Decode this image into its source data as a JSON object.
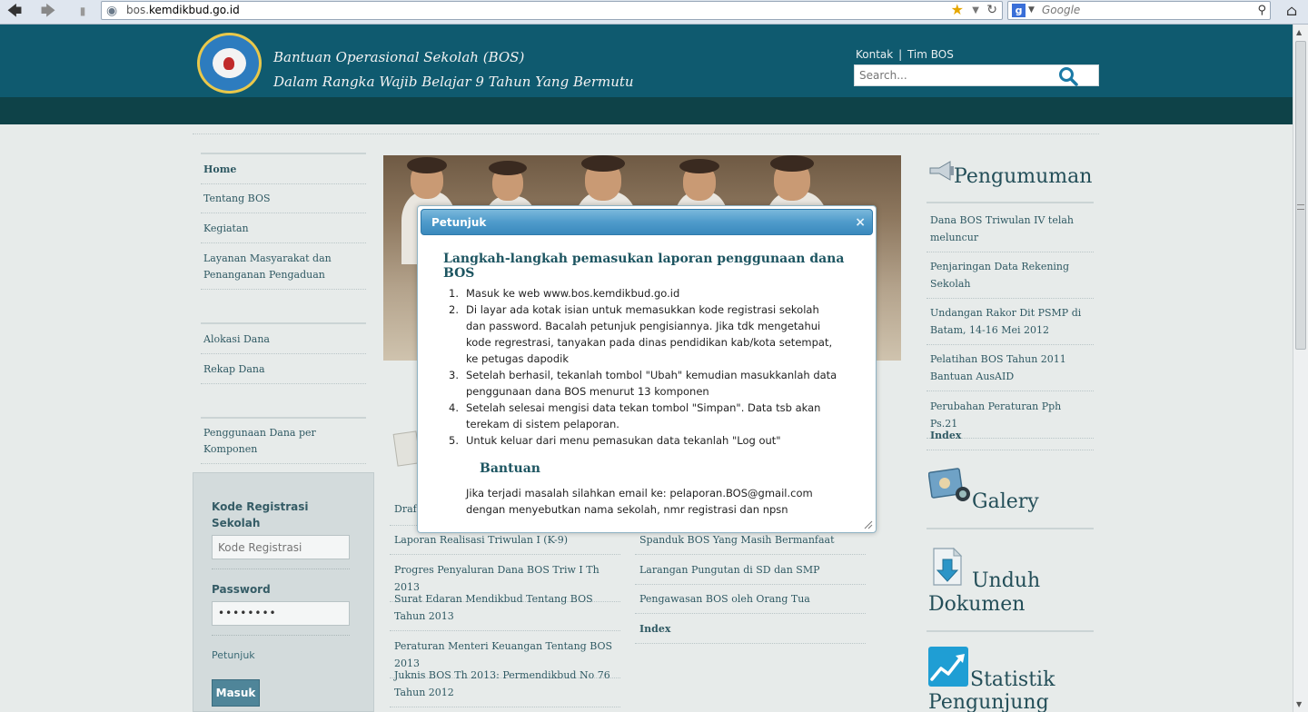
{
  "browser": {
    "url_prefix": "bos.",
    "url_domain": "kemdikbud.go.id",
    "search_placeholder": "Google",
    "search_engine_letter": "g",
    "back_icon": "back-arrow-icon",
    "forward_icon": "forward-arrow-icon"
  },
  "header": {
    "title_line1": "Bantuan Operasional Sekolah (BOS)",
    "title_line2": "Dalam Rangka Wajib Belajar 9 Tahun Yang Bermutu",
    "link_contact": "Kontak",
    "separator": "|",
    "link_team": "Tim BOS",
    "search_placeholder": "Search...",
    "brand_color": "#0f5a6f",
    "band_color": "#0e4248"
  },
  "left_nav": {
    "items": [
      "Home",
      "Tentang BOS",
      "Kegiatan",
      "Layanan Masyarakat dan Penanganan Pengaduan",
      "Alokasi Dana",
      "Rekap Dana",
      "Penggunaan Dana per Komponen"
    ]
  },
  "login": {
    "code_label": "Kode Registrasi Sekolah",
    "code_placeholder": "Kode Registrasi",
    "password_label": "Password",
    "password_value": "••••••••",
    "help_link": "Petunjuk",
    "submit_label": "Masuk"
  },
  "center_lists": {
    "left": [
      "Draft",
      "Laporan Realisasi Triwulan I (K-9)",
      "Progres Penyaluran Dana BOS Triw I Th 2013",
      "Surat Edaran Mendikbud Tentang BOS Tahun 2013",
      "Peraturan Menteri Keuangan Tentang BOS 2013",
      "Juknis BOS Th 2013: Permendikbud No 76 Tahun 2012"
    ],
    "right": [
      "Spanduk BOS Yang Masih Bermanfaat",
      "Larangan Pungutan di SD dan SMP",
      "Pengawasan BOS oleh Orang Tua",
      "Index"
    ]
  },
  "right_sidebar": {
    "announcements_title": "Pengumuman",
    "announcements": [
      "Dana BOS Triwulan IV telah meluncur",
      "Penjaringan Data Rekening Sekolah",
      "Undangan Rakor Dit PSMP di Batam, 14-16 Mei 2012",
      "Pelatihan BOS Tahun 2011 Bantuan AusAID",
      "Perubahan Peraturan Pph Ps.21",
      "Index"
    ],
    "gallery_title": "Galery",
    "download_title_1": "Unduh",
    "download_title_2": "Dokumen",
    "stats_title_1": "Statistik",
    "stats_title_2": "Pengunjung"
  },
  "modal": {
    "title": "Petunjuk",
    "close": "×",
    "heading": "Langkah-langkah pemasukan laporan penggunaan dana BOS",
    "steps": [
      "Masuk ke web www.bos.kemdikbud.go.id",
      "Di layar ada kotak isian untuk memasukkan kode registrasi sekolah dan password. Bacalah petunjuk pengisiannya. Jika tdk mengetahui kode regrestrasi, tanyakan pada dinas pendidikan kab/kota setempat, ke petugas dapodik",
      "Setelah berhasil, tekanlah tombol \"Ubah\" kemudian masukkanlah data penggunaan dana BOS menurut 13 komponen",
      "Setelah selesai mengisi data tekan tombol \"Simpan\". Data tsb akan terekam di sistem pelaporan.",
      "Untuk keluar dari menu pemasukan data tekanlah \"Log out\""
    ],
    "help_heading": "Bantuan",
    "help_text": "Jika terjadi masalah silahkan email ke: pelaporan.BOS@gmail.com dengan menyebutkan nama sekolah, nmr registrasi dan npsn"
  }
}
